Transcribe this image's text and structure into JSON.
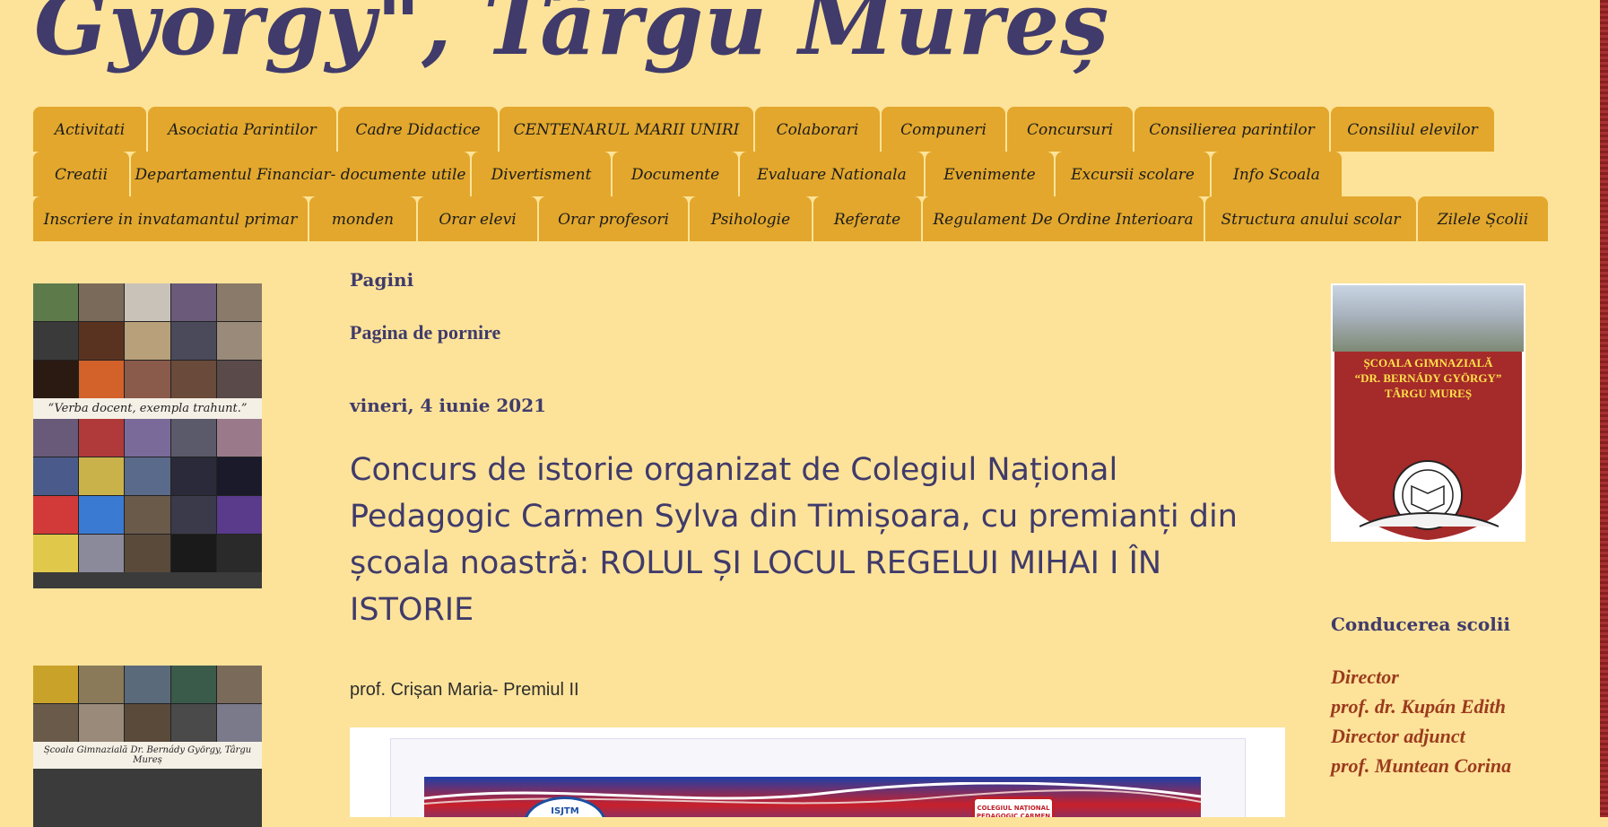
{
  "header": {
    "title": "György\", Târgu Mureș"
  },
  "nav": {
    "rows": [
      [
        "Activitati",
        "Asociatia Parintilor",
        "Cadre Didactice",
        "CENTENARUL MARII UNIRI",
        "Colaborari",
        "Compuneri",
        "Concursuri",
        "Consilierea parintilor",
        "Consiliul elevilor"
      ],
      [
        "Creatii",
        "Departamentul Financiar- documente utile",
        "Divertisment",
        "Documente",
        "Evaluare Nationala",
        "Evenimente",
        "Excursii scolare",
        "Info Scoala"
      ],
      [
        "Inscriere in invatamantul primar",
        "monden",
        "Orar elevi",
        "Orar profesori",
        "Psihologie",
        "Referate",
        "Regulament De Ordine Interioara",
        "Structura anului scolar",
        "Zilele Școlii"
      ]
    ]
  },
  "left_sidebar": {
    "collage_1_caption": "“Verba docent, exempla trahunt.”",
    "collage_2_caption": "Școala Gimnazială Dr. Bernády György, Târgu Mureș"
  },
  "main": {
    "pages_heading": "Pagini",
    "home_link": "Pagina de pornire",
    "post_date": "vineri, 4 iunie 2021",
    "post_title": "Concurs de istorie organizat de Colegiul Național Pedagogic Carmen Sylva din Timișoara, cu premianți din școala noastră: ROLUL ȘI LOCUL REGELUI MIHAI I ÎN ISTORIE",
    "post_author": "prof. Crișan Maria- Premiul II",
    "image_badge_left": "ISJTM",
    "image_badge_right": "COLEGIUL NAȚIONAL PEDAGOGIC CARMEN SYLVA"
  },
  "right_sidebar": {
    "logo_text": [
      "ȘCOALA GIMNAZIALĂ",
      "“DR. BERNÁDY GYÖRGY”",
      "TÂRGU MUREȘ"
    ],
    "heading": "Conducerea scolii",
    "leadership": [
      "Director",
      "prof. dr. Kupán Edith",
      "Director adjunct",
      "prof. Muntean Corina"
    ]
  },
  "colors": {
    "background": "#fde399",
    "tab": "#e2a72c",
    "heading": "#403b6b",
    "leadership": "#9b3b1e"
  }
}
